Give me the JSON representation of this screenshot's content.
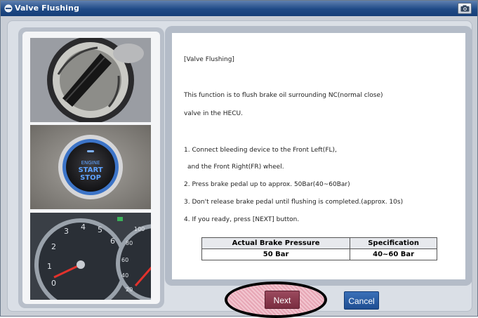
{
  "window": {
    "title": "Valve Flushing",
    "title_icon": "valve-drop-icon",
    "camera_icon": "camera-icon"
  },
  "images": [
    {
      "name": "ignition-key-photo"
    },
    {
      "name": "engine-start-stop-button-photo",
      "labels": [
        "ENGINE",
        "START",
        "STOP"
      ]
    },
    {
      "name": "instrument-cluster-photo"
    }
  ],
  "instructions": {
    "heading": "[Valve Flushing]",
    "intro_1": "This function is to flush brake oil surrounding NC(normal close)",
    "intro_2": "valve in the HECU.",
    "step_1a": "1. Connect bleeding device to the Front Left(FL),",
    "step_1b": "and the Front Right(FR) wheel.",
    "step_2": "2. Press brake pedal up to approx. 50Bar(40~60Bar)",
    "step_3": "3. Don't release brake pedal until flushing is completed.(approx. 10s)",
    "step_4": "4. If you ready, press [NEXT] button."
  },
  "table": {
    "headers": [
      "Actual Brake Pressure",
      "Specification"
    ],
    "row": [
      "50 Bar",
      "40~60 Bar"
    ]
  },
  "buttons": {
    "next": "Next",
    "cancel": "Cancel"
  },
  "colors": {
    "titlebar": "#1f4a86",
    "next_button": "#7a2d40",
    "cancel_button": "#1f4e92",
    "highlight": "#e7a6b5"
  }
}
